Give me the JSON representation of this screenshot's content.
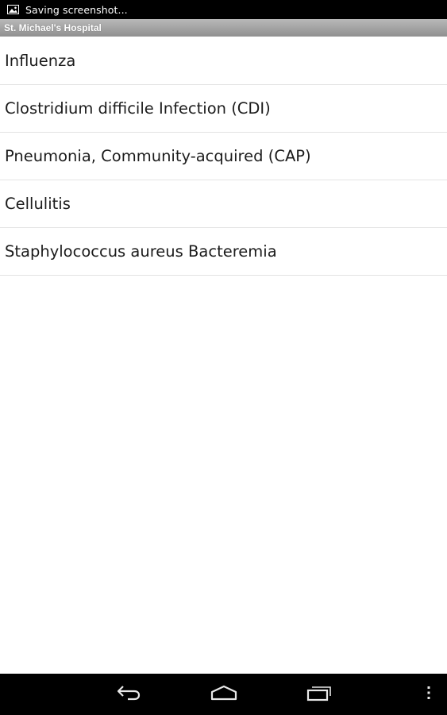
{
  "status_bar": {
    "notification_icon": "image-icon",
    "text": "Saving screenshot..."
  },
  "app_bar": {
    "title": "St. Michael's Hospital"
  },
  "list": {
    "items": [
      {
        "label": "Influenza"
      },
      {
        "label": "Clostridium difficile Infection (CDI)"
      },
      {
        "label": "Pneumonia, Community-acquired (CAP)"
      },
      {
        "label": "Cellulitis"
      },
      {
        "label": "Staphylococcus aureus Bacteremia"
      }
    ]
  },
  "nav_bar": {
    "back_icon": "back-icon",
    "home_icon": "home-icon",
    "recents_icon": "recent-apps-icon",
    "menu_icon": "overflow-menu-icon"
  },
  "colors": {
    "status_bar_bg": "#000000",
    "title_bar_bg": "#a3a3a3",
    "list_bg": "#ffffff",
    "divider": "#e3e3e3",
    "text": "#1c1c1c"
  }
}
